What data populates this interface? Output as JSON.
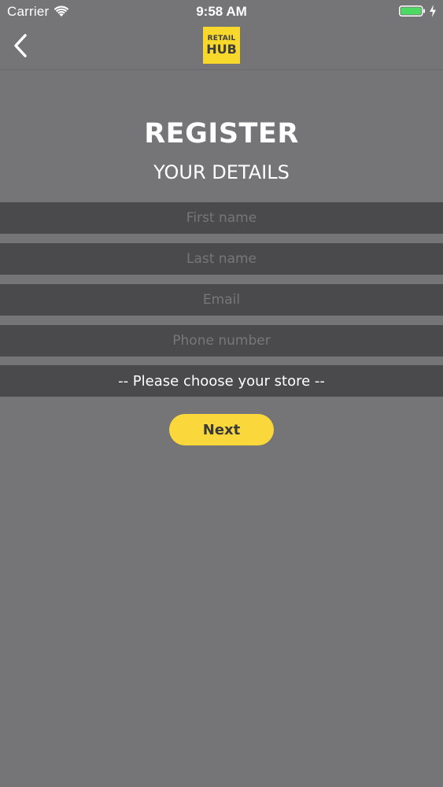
{
  "status_bar": {
    "carrier": "Carrier",
    "time": "9:58 AM",
    "wifi_icon": "wifi-icon",
    "battery_icon": "battery-charging-icon",
    "battery_color": "#4cd964"
  },
  "nav": {
    "back_icon": "chevron-left-icon",
    "logo_line1": "RETAIL",
    "logo_line2": "HUB",
    "logo_color": "#f7d82b"
  },
  "header": {
    "title": "REGISTER",
    "subtitle": "YOUR DETAILS"
  },
  "form": {
    "first_name": {
      "value": "",
      "placeholder": "First name"
    },
    "last_name": {
      "value": "",
      "placeholder": "Last name"
    },
    "email": {
      "value": "",
      "placeholder": "Email"
    },
    "phone": {
      "value": "",
      "placeholder": "Phone number"
    },
    "store_select": "-- Please choose your store --"
  },
  "next_button": {
    "label": "Next",
    "color": "#fad83c"
  }
}
